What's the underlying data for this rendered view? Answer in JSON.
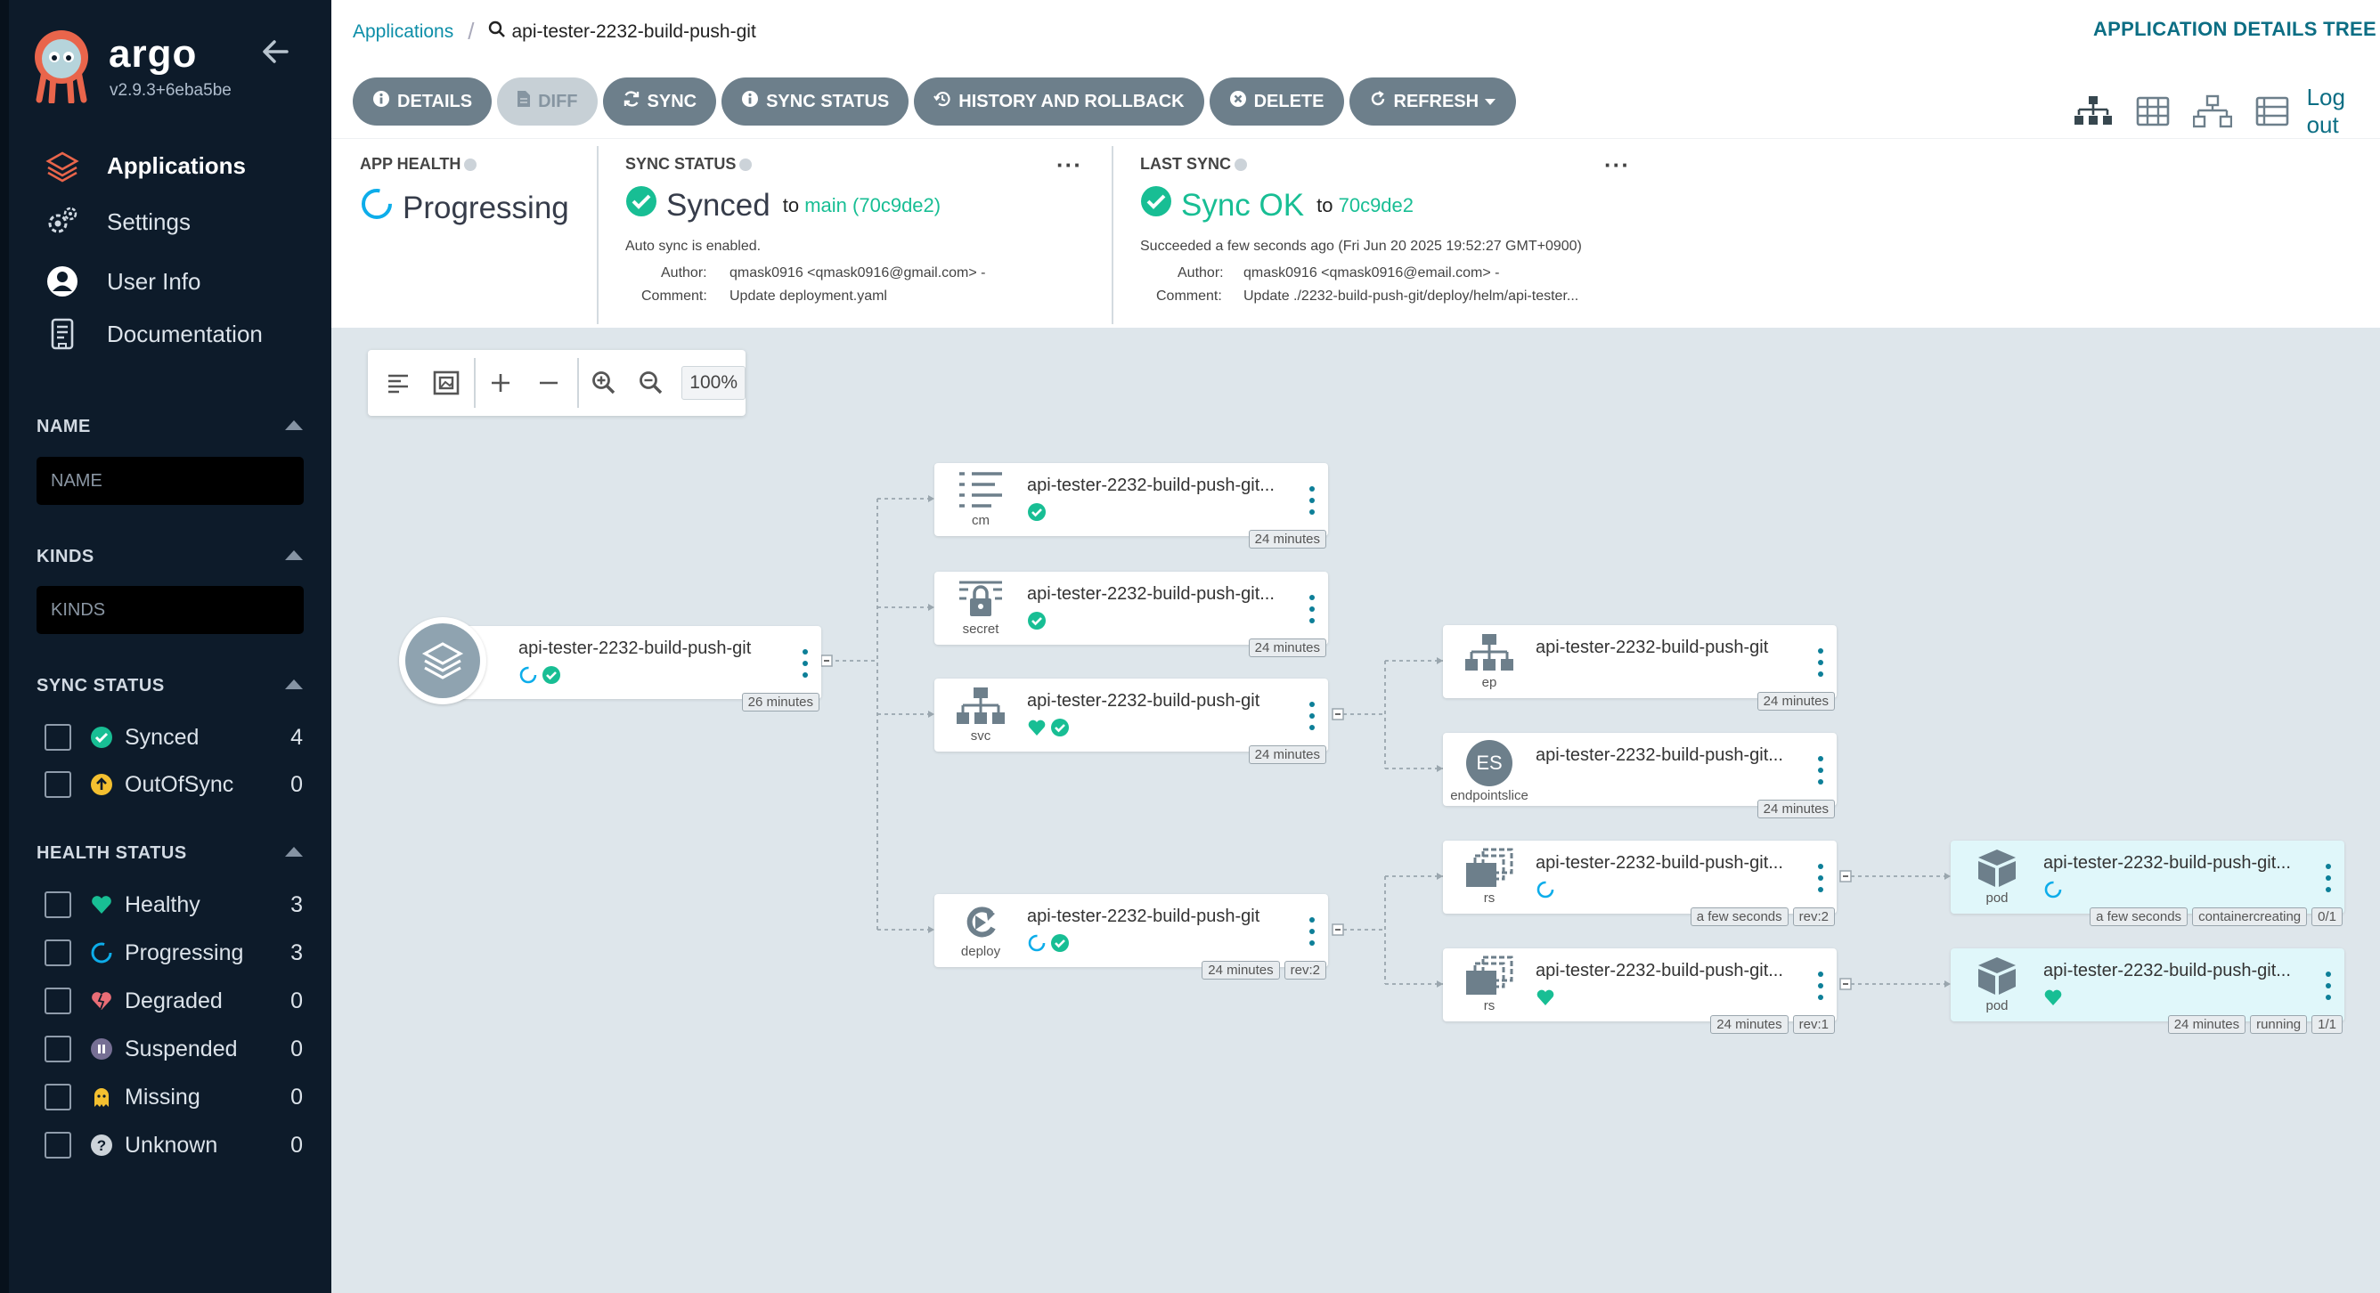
{
  "app": {
    "name": "argo",
    "version": "v2.9.3+6eba5be"
  },
  "sidebar": {
    "nav": [
      {
        "label": "Applications"
      },
      {
        "label": "Settings"
      },
      {
        "label": "User Info"
      },
      {
        "label": "Documentation"
      }
    ],
    "name_filter": {
      "title": "NAME",
      "placeholder": "NAME"
    },
    "kinds_filter": {
      "title": "KINDS",
      "placeholder": "KINDS"
    },
    "sync_status": {
      "title": "SYNC STATUS",
      "items": [
        {
          "label": "Synced",
          "count": "4"
        },
        {
          "label": "OutOfSync",
          "count": "0"
        }
      ]
    },
    "health_status": {
      "title": "HEALTH STATUS",
      "items": [
        {
          "label": "Healthy",
          "count": "3"
        },
        {
          "label": "Progressing",
          "count": "3"
        },
        {
          "label": "Degraded",
          "count": "0"
        },
        {
          "label": "Suspended",
          "count": "0"
        },
        {
          "label": "Missing",
          "count": "0"
        },
        {
          "label": "Unknown",
          "count": "0"
        }
      ]
    }
  },
  "header": {
    "breadcrumb_root": "Applications",
    "breadcrumb_current": "api-tester-2232-build-push-git",
    "title": "APPLICATION DETAILS TREE",
    "logout": "Log out"
  },
  "toolbar": [
    {
      "label": "DETAILS",
      "icon": "info-icon"
    },
    {
      "label": "DIFF",
      "icon": "file-icon"
    },
    {
      "label": "SYNC",
      "icon": "sync-icon"
    },
    {
      "label": "SYNC STATUS",
      "icon": "info-icon"
    },
    {
      "label": "HISTORY AND ROLLBACK",
      "icon": "history-icon"
    },
    {
      "label": "DELETE",
      "icon": "close-circle-icon"
    },
    {
      "label": "REFRESH",
      "icon": "refresh-icon"
    }
  ],
  "status": {
    "app_health": {
      "label": "APP HEALTH",
      "value": "Progressing"
    },
    "sync_status": {
      "label": "SYNC STATUS",
      "value": "Synced",
      "to": "to",
      "revision": "main (70c9de2)",
      "auto_sync": "Auto sync is enabled.",
      "author_label": "Author:",
      "author": "qmask0916 <qmask0916@gmail.com> -",
      "comment_label": "Comment:",
      "comment": "Update deployment.yaml"
    },
    "last_sync": {
      "label": "LAST SYNC",
      "value": "Sync OK",
      "to": "to",
      "revision": "70c9de2",
      "succeeded": "Succeeded a few seconds ago (Fri Jun 20 2025 19:52:27 GMT+0900)",
      "author_label": "Author:",
      "author": "qmask0916 <qmask0916@email.com> -",
      "comment_label": "Comment:",
      "comment": "Update ./2232-build-push-git/deploy/helm/api-tester..."
    }
  },
  "graph_tools": {
    "zoom": "100%"
  },
  "colors": {
    "accent": "#0c8ea8",
    "synced": "#18be94",
    "progressing": "#0dadea",
    "degraded": "#e96d76",
    "suspended": "#766f94",
    "missing": "#f4c030",
    "sidebar": "#0d1b2a"
  },
  "nodes": {
    "root": {
      "name": "api-tester-2232-build-push-git",
      "age": "26 minutes"
    },
    "cm": {
      "kind": "cm",
      "name": "api-tester-2232-build-push-git...",
      "age": "24 minutes"
    },
    "secret": {
      "kind": "secret",
      "name": "api-tester-2232-build-push-git...",
      "age": "24 minutes"
    },
    "svc": {
      "kind": "svc",
      "name": "api-tester-2232-build-push-git",
      "age": "24 minutes"
    },
    "deploy": {
      "kind": "deploy",
      "name": "api-tester-2232-build-push-git",
      "age": "24 minutes",
      "rev": "rev:2"
    },
    "ep": {
      "kind": "ep",
      "name": "api-tester-2232-build-push-git",
      "age": "24 minutes"
    },
    "eps": {
      "kind": "endpointslice",
      "badge": "ES",
      "name": "api-tester-2232-build-push-git...",
      "age": "24 minutes"
    },
    "rs1": {
      "kind": "rs",
      "name": "api-tester-2232-build-push-git...",
      "age": "a few seconds",
      "rev": "rev:2"
    },
    "rs2": {
      "kind": "rs",
      "name": "api-tester-2232-build-push-git...",
      "age": "24 minutes",
      "rev": "rev:1"
    },
    "pod1": {
      "kind": "pod",
      "name": "api-tester-2232-build-push-git...",
      "age": "a few seconds",
      "state": "containercreating",
      "ready": "0/1"
    },
    "pod2": {
      "kind": "pod",
      "name": "api-tester-2232-build-push-git...",
      "age": "24 minutes",
      "state": "running",
      "ready": "1/1"
    }
  }
}
